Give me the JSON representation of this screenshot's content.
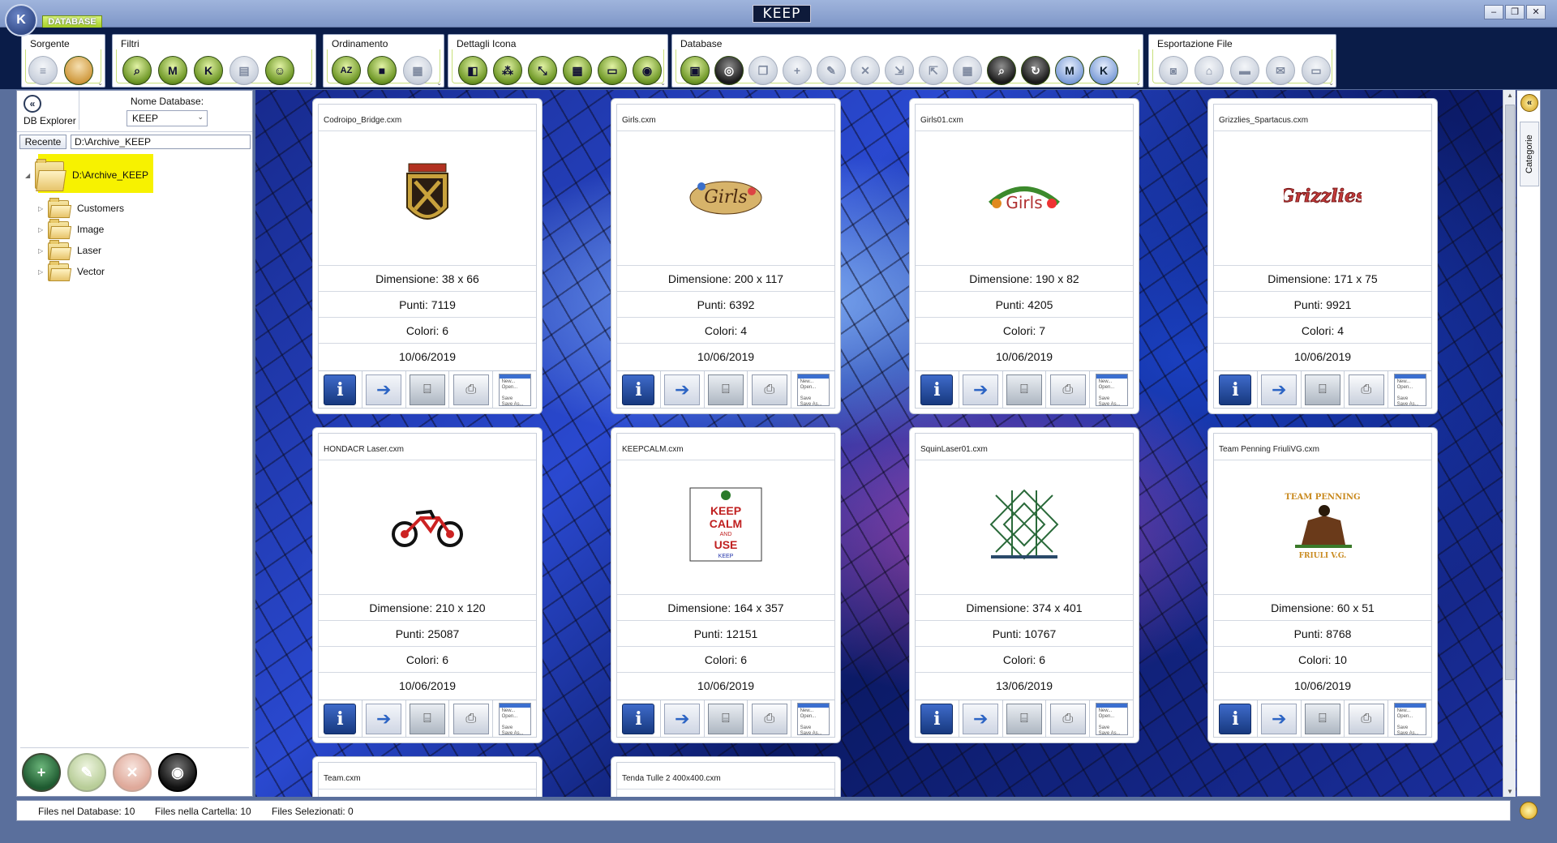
{
  "window": {
    "app_button": "K",
    "tab_label": "DATABASE",
    "title": "KEEP",
    "controls": [
      "–",
      "❐",
      "✕"
    ]
  },
  "ribbon": {
    "groups": [
      {
        "label": "Sorgente",
        "icons": [
          "database-icon",
          "folder-open-icon"
        ]
      },
      {
        "label": "Filtri",
        "icons": [
          "magnifier-icon",
          "filter-m-icon",
          "filter-k-icon",
          "filter-list-icon",
          "filter-user-icon"
        ]
      },
      {
        "label": "Ordinamento",
        "icons": [
          "sort-az-icon",
          "sort-color-icon",
          "sort-date-icon"
        ]
      },
      {
        "label": "Dettagli Icona",
        "icons": [
          "detail-color-icon",
          "detail-stitch-icon",
          "detail-size-icon",
          "detail-date-icon",
          "detail-label-icon",
          "detail-thumb-icon"
        ]
      },
      {
        "label": "Database",
        "icons": [
          "db-open-icon",
          "db-record-icon",
          "db-copy-icon",
          "db-add-icon",
          "db-edit-icon",
          "db-delete-icon",
          "db-import-icon",
          "db-export-icon",
          "db-grid-icon",
          "db-scan-icon",
          "db-refresh-icon",
          "db-m-icon",
          "db-k-icon"
        ]
      },
      {
        "label": "Esportazione File",
        "icons": [
          "export-disk-icon",
          "export-machine-icon",
          "export-usb-icon",
          "export-mail-icon",
          "export-screen-icon"
        ]
      }
    ]
  },
  "left_panel": {
    "db_explorer_label": "DB Explorer",
    "db_name_label": "Nome Database:",
    "db_name_value": "KEEP",
    "recent_button": "Recente",
    "path_value": "D:\\Archive_KEEP",
    "tree_root": "D:\\Archive_KEEP",
    "tree_children": [
      "Customers",
      "Image",
      "Laser",
      "Vector"
    ],
    "bottom_buttons": [
      "add-icon",
      "edit-icon",
      "delete-icon",
      "view-icon"
    ]
  },
  "cards": [
    {
      "file": "Codroipo_Bridge.cxm",
      "dimensione": "Dimensione: 38 x 66",
      "punti": "Punti: 7119",
      "colori": "Colori: 6",
      "data": "10/06/2019",
      "thumb": "shield"
    },
    {
      "file": "Girls.cxm",
      "dimensione": "Dimensione: 200 x 117",
      "punti": "Punti: 6392",
      "colori": "Colori: 4",
      "data": "10/06/2019",
      "thumb": "girls"
    },
    {
      "file": "Girls01.cxm",
      "dimensione": "Dimensione: 190 x 82",
      "punti": "Punti: 4205",
      "colori": "Colori: 7",
      "data": "10/06/2019",
      "thumb": "girls01"
    },
    {
      "file": "Grizzlies_Spartacus.cxm",
      "dimensione": "Dimensione: 171 x 75",
      "punti": "Punti: 9921",
      "colori": "Colori: 4",
      "data": "10/06/2019",
      "thumb": "grizzlies"
    },
    {
      "file": "HONDACR Laser.cxm",
      "dimensione": "Dimensione: 210 x 120",
      "punti": "Punti: 25087",
      "colori": "Colori: 6",
      "data": "10/06/2019",
      "thumb": "bike"
    },
    {
      "file": "KEEPCALM.cxm",
      "dimensione": "Dimensione: 164 x 357",
      "punti": "Punti: 12151",
      "colori": "Colori: 6",
      "data": "10/06/2019",
      "thumb": "keepcalm"
    },
    {
      "file": "SquinLaser01.cxm",
      "dimensione": "Dimensione: 374 x 401",
      "punti": "Punti: 10767",
      "colori": "Colori: 6",
      "data": "13/06/2019",
      "thumb": "squin"
    },
    {
      "file": "Team Penning FriuliVG.cxm",
      "dimensione": "Dimensione: 60 x 51",
      "punti": "Punti: 8768",
      "colori": "Colori: 10",
      "data": "10/06/2019",
      "thumb": "team"
    },
    {
      "file": "Team.cxm"
    },
    {
      "file": "Tenda Tulle 2 400x400.cxm"
    }
  ],
  "thumb_text": {
    "keepcalm": [
      "KEEP",
      "CALM",
      "AND",
      "USE",
      "KEEP"
    ],
    "team": [
      "TEAM PENNING",
      "FRIULI V.G."
    ],
    "grizzlies": "Grizzlies",
    "girls": "Girls",
    "girls01": "Girls"
  },
  "tools": [
    "info-icon",
    "send-arrow-icon",
    "embroidery-machine-icon",
    "printer-icon",
    "document-report-icon"
  ],
  "tool_labels": {
    "info": "i",
    "doc": [
      "New...",
      "Open...",
      "Save",
      "Save As..."
    ]
  },
  "right_panel": {
    "categories_label": "Categorie"
  },
  "status": {
    "files_db": "Files nel Database: 10",
    "files_folder": "Files nella Cartella: 10",
    "files_selected": "Files Selezionati: 0"
  },
  "colors": {
    "ribbon_bg": "#0a1c48",
    "highlight": "#f7f200",
    "accent_green": "#a6cf25",
    "info_blue": "#17397f"
  }
}
